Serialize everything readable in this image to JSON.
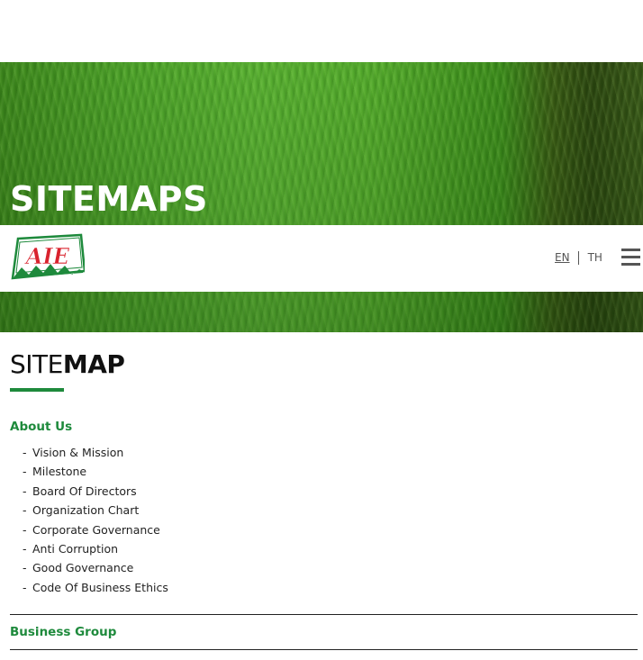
{
  "hero": {
    "title": "SITEMAPS"
  },
  "navbar": {
    "logo_text": "AIE",
    "lang_en": "EN",
    "lang_th": "TH"
  },
  "sitemap": {
    "title_light": "SITE",
    "title_bold": "MAP",
    "sections": [
      {
        "heading": "About Us",
        "items": [
          "Vision & Mission",
          "Milestone",
          "Board Of Directors",
          "Organization Chart",
          "Corporate Governance",
          "Anti Corruption",
          "Good Governance",
          "Code Of Business Ethics"
        ]
      },
      {
        "heading": "Business Group",
        "items": []
      }
    ]
  },
  "colors": {
    "accent": "#1e8a3c",
    "logo_red": "#d9232e",
    "logo_green": "#1e8a3c"
  },
  "icons": {
    "menu": "hamburger-menu-icon"
  }
}
